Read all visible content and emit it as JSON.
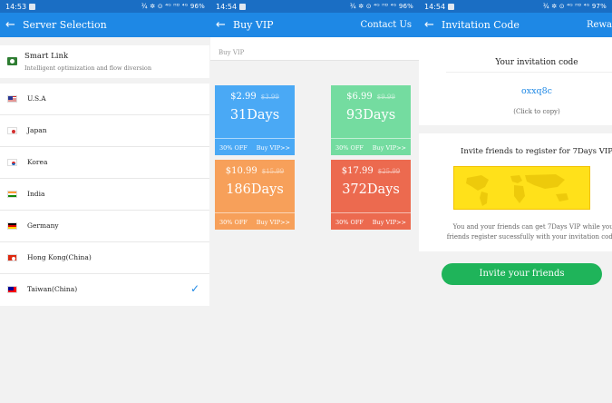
{
  "screens": [
    {
      "status": {
        "time": "14:53",
        "icons": "¾ ✲ ⊙ ⁴ᴳ ᴴᴰ ⁴ᴳ 96%"
      },
      "title": "Server Selection",
      "smart_link": {
        "title": "Smart Link",
        "subtitle": "Intelligent optimization and flow diversion"
      },
      "servers": [
        {
          "name": "U.S.A",
          "flag": "us-flag-icon",
          "selected": false
        },
        {
          "name": "Japan",
          "flag": "japan-flag-icon",
          "selected": false
        },
        {
          "name": "Korea",
          "flag": "korea-flag-icon",
          "selected": false
        },
        {
          "name": "India",
          "flag": "india-flag-icon",
          "selected": false
        },
        {
          "name": "Germany",
          "flag": "germany-flag-icon",
          "selected": false
        },
        {
          "name": "Hong Kong(China)",
          "flag": "hongkong-flag-icon",
          "selected": false
        },
        {
          "name": "Taiwan(China)",
          "flag": "taiwan-flag-icon",
          "selected": true
        }
      ]
    },
    {
      "status": {
        "time": "14:54",
        "icons": "¾ ✲ ⊙ ⁴ᴳ ᴴᴰ ⁴ᴳ 96%"
      },
      "title": "Buy VIP",
      "contact_label": "Contact Us",
      "section_label": "Buy VIP",
      "plans": [
        {
          "price": "$2.99",
          "old_price": "$3.99",
          "days": "31Days",
          "discount": "30% OFF",
          "buy": "Buy VIP>>",
          "color": "#4aa9f5"
        },
        {
          "price": "$6.99",
          "old_price": "$9.99",
          "days": "93Days",
          "discount": "30% OFF",
          "buy": "Buy VIP>>",
          "color": "#74dca0"
        },
        {
          "price": "$10.99",
          "old_price": "$15.99",
          "days": "186Days",
          "discount": "30% OFF",
          "buy": "Buy VIP>>",
          "color": "#f7a05a"
        },
        {
          "price": "$17.99",
          "old_price": "$25.99",
          "days": "372Days",
          "discount": "30% OFF",
          "buy": "Buy VIP>>",
          "color": "#ec6a4f"
        }
      ]
    },
    {
      "status": {
        "time": "14:54",
        "icons": "¾ ✲ ⊙ ⁴ᴳ ᴴᴰ ⁴ᴳ 97%"
      },
      "title": "Invitation Code",
      "reward_label": "Rewa",
      "code_label": "Your invitation code",
      "code": "oxxq8c",
      "copy_hint": "(Click to copy)",
      "invite_title": "Invite friends to register for 7Days VIP",
      "invite_desc_line1": "You and your friends can get 7Days VIP while your",
      "invite_desc_line2": "friends register sucessfully with your invitation code",
      "invite_button": "Invite your friends"
    }
  ],
  "colors": {
    "status_bar": "#1a6ec4",
    "app_bar": "#1e88e5",
    "accent": "#1e88e5",
    "invite_button": "#1fb45a",
    "map": "#ffe11a"
  }
}
